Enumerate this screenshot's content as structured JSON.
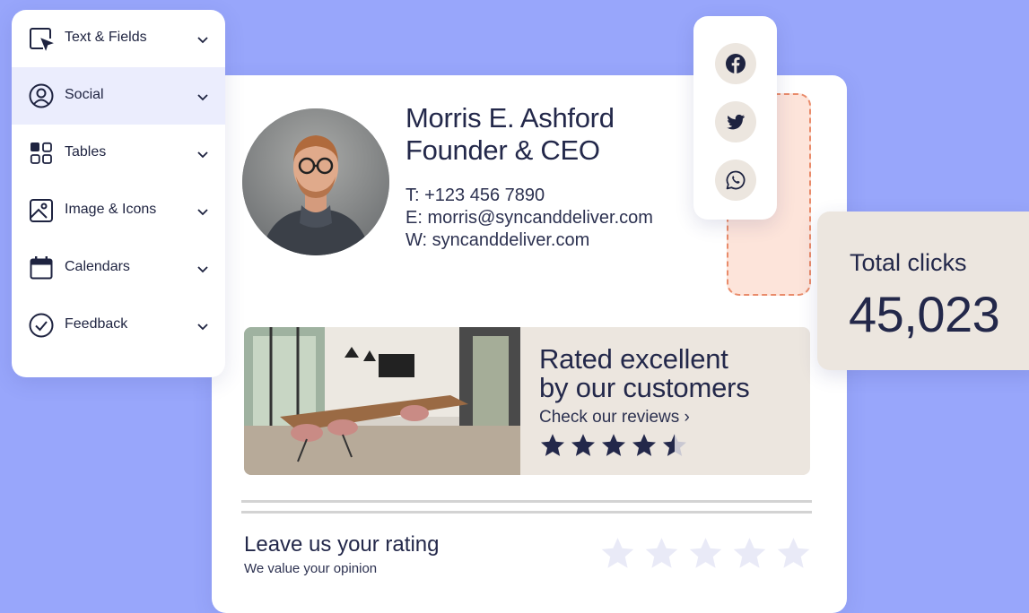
{
  "menu": {
    "items": [
      {
        "label": "Text & Fields",
        "icon": "cursor-select-icon"
      },
      {
        "label": "Social",
        "icon": "user-circle-icon",
        "active": true
      },
      {
        "label": "Tables",
        "icon": "grid-icon"
      },
      {
        "label": "Image & Icons",
        "icon": "image-icon"
      },
      {
        "label": "Calendars",
        "icon": "calendar-icon"
      },
      {
        "label": "Feedback",
        "icon": "check-circle-icon"
      }
    ]
  },
  "signature": {
    "name": "Morris E. Ashford",
    "role": "Founder & CEO",
    "phone": "T: +123 456 7890",
    "email": "E: morris@syncanddeliver.com",
    "web": "W: syncanddeliver.com"
  },
  "social": {
    "icons": [
      "facebook-icon",
      "twitter-icon",
      "whatsapp-icon"
    ]
  },
  "banner": {
    "title_line1": "Rated excellent",
    "title_line2": "by our customers",
    "link": "Check our reviews ›",
    "rating": 4.5,
    "max": 5
  },
  "rating_prompt": {
    "title": "Leave us your rating",
    "subtitle": "We value your opinion",
    "stars": 5
  },
  "stats": {
    "label": "Total clicks",
    "value": "45,023"
  },
  "colors": {
    "background": "#98a6fb",
    "accent_active": "#ebedfd",
    "beige": "#ece6df",
    "peach": "#fde4da",
    "text_dark": "#23284a"
  }
}
